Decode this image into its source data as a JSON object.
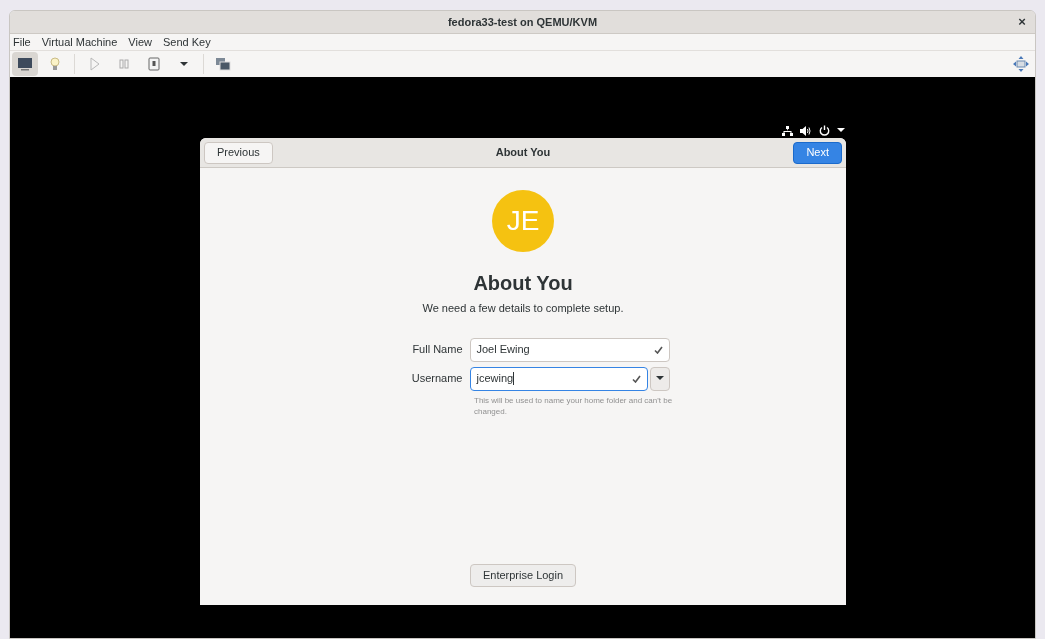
{
  "window": {
    "title": "fedora33-test on QEMU/KVM",
    "close": "×"
  },
  "menu": [
    "File",
    "Virtual Machine",
    "View",
    "Send Key"
  ],
  "toolbar": [
    {
      "kind": "console",
      "selected": true
    },
    {
      "kind": "details",
      "selected": false
    },
    {
      "kind": "sep"
    },
    {
      "kind": "run",
      "selected": false
    },
    {
      "kind": "pause",
      "selected": false
    },
    {
      "kind": "shutdown",
      "selected": false
    },
    {
      "kind": "caret",
      "selected": false
    },
    {
      "kind": "sep"
    },
    {
      "kind": "snapshots",
      "selected": false
    }
  ],
  "dialog": {
    "previous": "Previous",
    "title": "About You",
    "next": "Next",
    "initials": "JE",
    "heading": "About You",
    "subtitle": "We need a few details to complete setup.",
    "fields": [
      {
        "label": "Full Name",
        "value": "Joel Ewing",
        "valid": true,
        "focused": false,
        "dropdown": false
      },
      {
        "label": "Username",
        "value": "jcewing",
        "valid": true,
        "focused": true,
        "dropdown": true
      }
    ],
    "hint": "This will be used to name your home folder and can't be changed.",
    "enterprise": "Enterprise Login"
  }
}
